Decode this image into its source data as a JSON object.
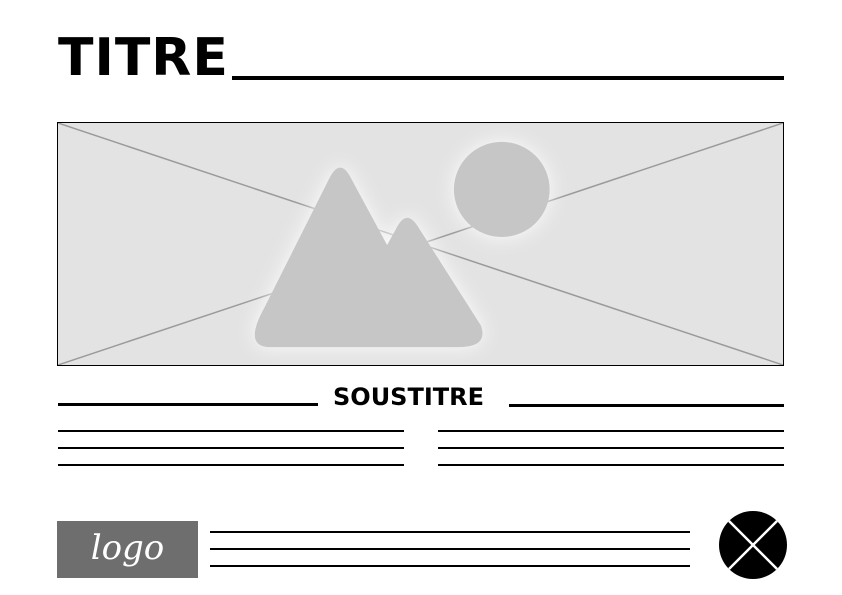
{
  "header": {
    "title": "TITRE"
  },
  "image": {
    "icon": "image-placeholder-icon"
  },
  "section": {
    "subtitle": "SOUSTITRE"
  },
  "footer": {
    "logo_text": "logo",
    "close_icon": "close-icon"
  },
  "colors": {
    "text": "#000000",
    "placeholder_bg": "#e3e3e3",
    "placeholder_shape": "#c6c6c6",
    "placeholder_diagonal": "#9a9a9a",
    "logo_bg": "#6e6e6e",
    "logo_text": "#ffffff"
  }
}
